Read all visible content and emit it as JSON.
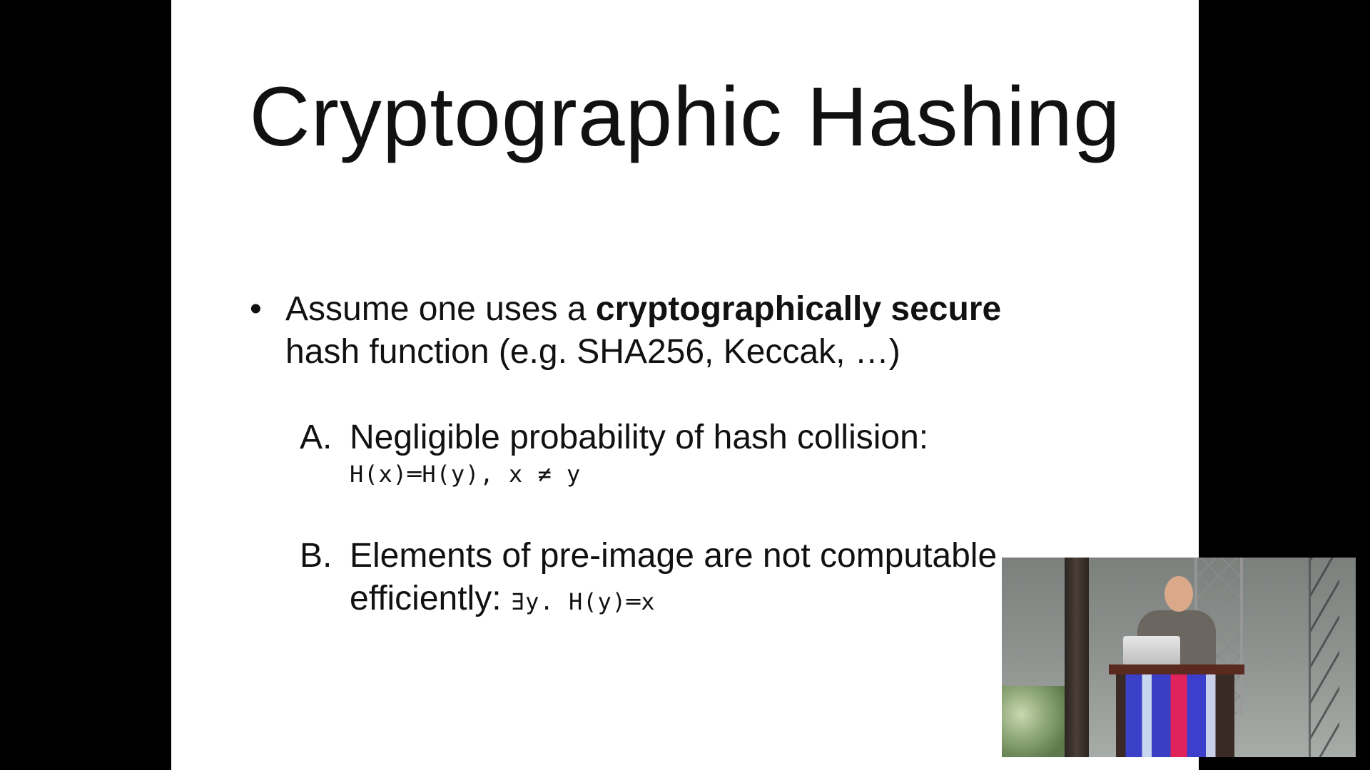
{
  "slide": {
    "title": "Cryptographic Hashing",
    "bullet": {
      "symbol": "•",
      "text_pre": "Assume one uses a ",
      "text_bold": "cryptographically secure",
      "text_post": "hash function (e.g. SHA256, Keccak, …)"
    },
    "items": [
      {
        "letter": "A.",
        "text": "Negligible probability of hash collision:",
        "formula": "H(x)═H(y), x ≠ y"
      },
      {
        "letter": "B.",
        "text_line1": "Elements of pre-image are not computable",
        "text_line2": "efficiently:",
        "formula": "∃y. H(y)═x"
      }
    ]
  },
  "video_overlay": {
    "lectern_colors": [
      "#3a40c8",
      "#e0235a",
      "#c9d6f0"
    ]
  }
}
